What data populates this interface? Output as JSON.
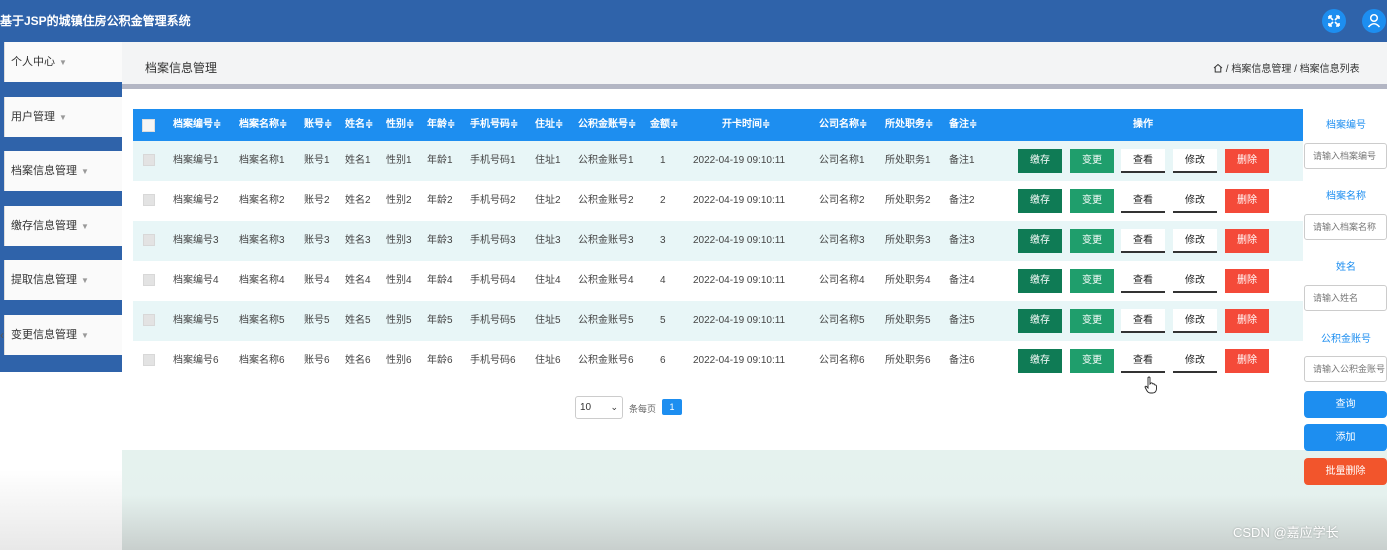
{
  "app_title": "基于JSP的城镇住房公积金管理系统",
  "sidebar": {
    "items": [
      {
        "label": "个人中心"
      },
      {
        "label": "用户管理"
      },
      {
        "label": "档案信息管理"
      },
      {
        "label": "缴存信息管理"
      },
      {
        "label": "提取信息管理"
      },
      {
        "label": "变更信息管理"
      }
    ]
  },
  "header": {
    "title": "档案信息管理",
    "breadcrumb": "/ 档案信息管理 / 档案信息列表"
  },
  "table": {
    "columns": [
      "档案编号≑",
      "档案名称≑",
      "账号≑",
      "姓名≑",
      "性别≑",
      "年龄≑",
      "手机号码≑",
      "住址≑",
      "公积金账号≑",
      "金额≑",
      "开卡时间≑",
      "公司名称≑",
      "所处职务≑",
      "备注≑",
      "操作"
    ],
    "rows": [
      [
        "档案编号1",
        "档案名称1",
        "账号1",
        "姓名1",
        "性别1",
        "年龄1",
        "手机号码1",
        "住址1",
        "公积金账号1",
        "1",
        "2022-04-19 09:10:11",
        "公司名称1",
        "所处职务1",
        "备注1"
      ],
      [
        "档案编号2",
        "档案名称2",
        "账号2",
        "姓名2",
        "性别2",
        "年龄2",
        "手机号码2",
        "住址2",
        "公积金账号2",
        "2",
        "2022-04-19 09:10:11",
        "公司名称2",
        "所处职务2",
        "备注2"
      ],
      [
        "档案编号3",
        "档案名称3",
        "账号3",
        "姓名3",
        "性别3",
        "年龄3",
        "手机号码3",
        "住址3",
        "公积金账号3",
        "3",
        "2022-04-19 09:10:11",
        "公司名称3",
        "所处职务3",
        "备注3"
      ],
      [
        "档案编号4",
        "档案名称4",
        "账号4",
        "姓名4",
        "性别4",
        "年龄4",
        "手机号码4",
        "住址4",
        "公积金账号4",
        "4",
        "2022-04-19 09:10:11",
        "公司名称4",
        "所处职务4",
        "备注4"
      ],
      [
        "档案编号5",
        "档案名称5",
        "账号5",
        "姓名5",
        "性别5",
        "年龄5",
        "手机号码5",
        "住址5",
        "公积金账号5",
        "5",
        "2022-04-19 09:10:11",
        "公司名称5",
        "所处职务5",
        "备注5"
      ],
      [
        "档案编号6",
        "档案名称6",
        "账号6",
        "姓名6",
        "性别6",
        "年龄6",
        "手机号码6",
        "住址6",
        "公积金账号6",
        "6",
        "2022-04-19 09:10:11",
        "公司名称6",
        "所处职务6",
        "备注6"
      ]
    ],
    "actions": [
      "缴存",
      "变更",
      "查看",
      "修改",
      "删除"
    ]
  },
  "pagination": {
    "page_size": "10",
    "per_page_label": "条每页",
    "current_page": "1"
  },
  "search": {
    "fields": [
      {
        "label": "档案编号",
        "placeholder": "请输入档案编号"
      },
      {
        "label": "档案名称",
        "placeholder": "请输入档案名称"
      },
      {
        "label": "姓名",
        "placeholder": "请输入姓名"
      },
      {
        "label": "公积金账号",
        "placeholder": "请输入公积金账号"
      }
    ],
    "query_button": "查询",
    "add_button": "添加",
    "batch_delete_button": "批量删除"
  },
  "watermark": "CSDN @嘉应学长",
  "colors": {
    "topbar": "#2f63aa",
    "primary": "#1d8ef0",
    "deposit": "#0f7b55",
    "change": "#1f9e6c",
    "delete": "#f44a39"
  }
}
